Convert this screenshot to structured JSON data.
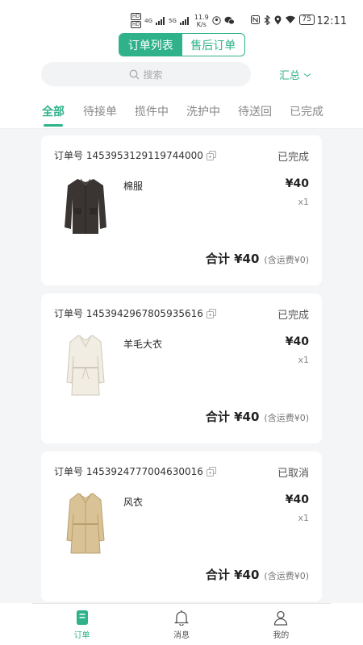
{
  "status_bar": {
    "hd1": "HD",
    "hd2": "HD",
    "net": "4G",
    "net2": "5G",
    "speed": "11.9",
    "speed_unit": "K/s",
    "battery": "75",
    "time": "12:11"
  },
  "header": {
    "tab_orders": "订单列表",
    "tab_aftersale": "售后订单"
  },
  "search": {
    "placeholder": "搜索"
  },
  "summary": {
    "label": "汇总"
  },
  "tabs": [
    {
      "label": "全部"
    },
    {
      "label": "待接单"
    },
    {
      "label": "揽件中"
    },
    {
      "label": "洗护中"
    },
    {
      "label": "待送回"
    },
    {
      "label": "已完成"
    }
  ],
  "orders": [
    {
      "order_no": "订单号 1453953129119744000",
      "status": "已完成",
      "item_name": "棉服",
      "price": "¥40",
      "qty": "x1",
      "total": "合计 ¥40",
      "total_note": "(含运费¥0)",
      "thumb_color": "#3a3532"
    },
    {
      "order_no": "订单号 1453942967805935616",
      "status": "已完成",
      "item_name": "羊毛大衣",
      "price": "¥40",
      "qty": "x1",
      "total": "合计 ¥40",
      "total_note": "(含运费¥0)",
      "thumb_color": "#f1ede3"
    },
    {
      "order_no": "订单号 1453924777004630016",
      "status": "已取消",
      "item_name": "风衣",
      "price": "¥40",
      "qty": "x1",
      "total": "合计 ¥40",
      "total_note": "(含运费¥0)",
      "thumb_color": "#d9c295"
    }
  ],
  "bottom_nav": [
    {
      "label": "订单",
      "icon": "order-icon",
      "active": true
    },
    {
      "label": "消息",
      "icon": "bell-icon",
      "active": false
    },
    {
      "label": "我的",
      "icon": "user-icon",
      "active": false
    }
  ],
  "colors": {
    "accent": "#2fb28a"
  }
}
